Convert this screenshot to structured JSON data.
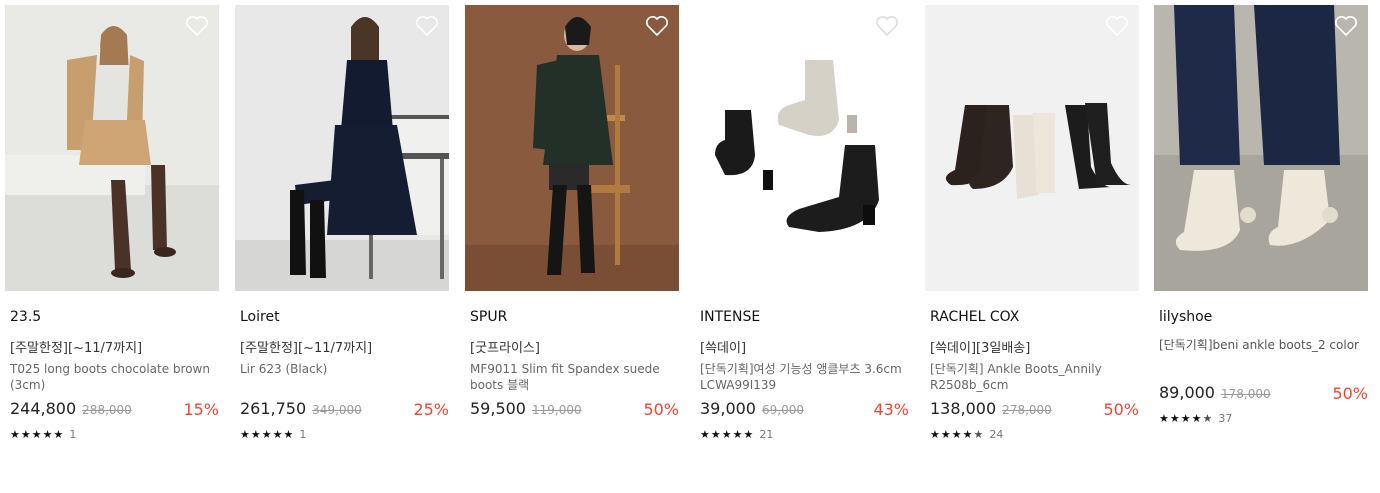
{
  "products": [
    {
      "brand": "23.5",
      "tag": "[주말한정][~11/7까지]",
      "name": "T025 long boots chocolate brown (3cm)",
      "price": "244,800",
      "original_price": "288,000",
      "discount": "15%",
      "rating": 5,
      "review_count": "1",
      "image": "woman-tan-vest-brown-knee-boots-photo",
      "wishlist_icon": "heart-outline-icon"
    },
    {
      "brand": "Loiret",
      "tag": "[주말한정][~11/7까지]",
      "name": "Lir 623 (Black)",
      "price": "261,750",
      "original_price": "349,000",
      "discount": "25%",
      "rating": 5,
      "review_count": "1",
      "image": "woman-black-dress-black-boots-bench-photo",
      "wishlist_icon": "heart-outline-icon"
    },
    {
      "brand": "SPUR",
      "tag": "[굿프라이스]",
      "name": "MF9011 Slim fit Spandex suede boots 블랙",
      "price": "59,500",
      "original_price": "119,000",
      "discount": "50%",
      "rating": 0,
      "review_count": "",
      "image": "woman-green-jacket-over-knee-boots-brown-bg-photo",
      "wishlist_icon": "heart-outline-icon"
    },
    {
      "brand": "INTENSE",
      "tag": "[쓱데이]",
      "name": "[단독기획]여성 기능성 앵클부츠 3.6cm LCWA99I139",
      "price": "39,000",
      "original_price": "69,000",
      "discount": "43%",
      "rating": 5,
      "review_count": "21",
      "image": "three-ankle-boots-black-beige-suede-photo",
      "wishlist_icon": "heart-outline-icon"
    },
    {
      "brand": "RACHEL COX",
      "tag": "[쓱데이][3일배송]",
      "name": "[단독기획] Ankle Boots_Annily R2508b_6cm",
      "price": "138,000",
      "original_price": "278,000",
      "discount": "50%",
      "rating": 4.5,
      "review_count": "24",
      "image": "ankle-boots-brown-ivory-black-lineup-photo",
      "wishlist_icon": "heart-outline-icon"
    },
    {
      "brand": "lilyshoe",
      "tag": "[단독기획]beni ankle boots_2 color",
      "name": "",
      "price": "89,000",
      "original_price": "178,000",
      "discount": "50%",
      "rating": 4.5,
      "review_count": "37",
      "image": "ivory-ankle-boots-navy-pants-photo",
      "wishlist_icon": "heart-outline-icon"
    }
  ],
  "colors": {
    "discount": "#f1452f",
    "text": "#222222",
    "muted": "#999999"
  }
}
